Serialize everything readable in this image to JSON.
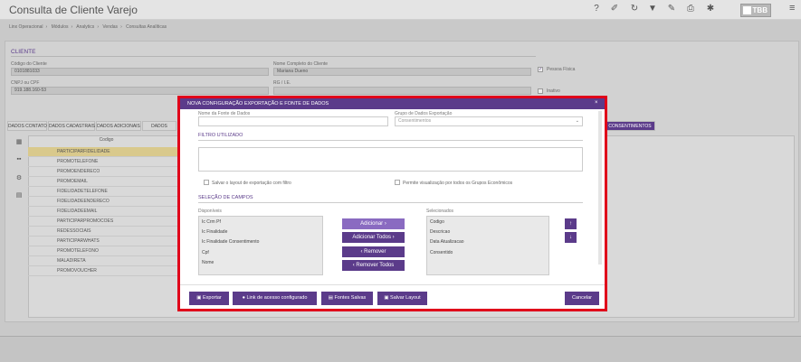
{
  "app": {
    "title": "Consulta de Cliente Varejo",
    "logo_text": "TBB"
  },
  "toolbar": {
    "icons": [
      "help-icon",
      "eraser-icon",
      "refresh-icon",
      "filter-icon",
      "edit-icon",
      "print-icon",
      "gear-icon"
    ],
    "glyphs": [
      "?",
      "✐",
      "↻",
      "▼",
      "✎",
      "⎙",
      "✱"
    ]
  },
  "breadcrumb": [
    "Linx Operacional",
    "Módulos",
    "Analytics",
    "Vendas",
    "Consultas Analíticas"
  ],
  "client": {
    "section_title": "CLIENTE",
    "code_label": "Código do Cliente",
    "code_value": "0101881033",
    "name_label": "Nome Completo do Cliente",
    "name_value": "Mariana Dueno",
    "cnpj_label": "CNPJ ou CPF",
    "cnpj_value": "919.188.160-53",
    "rg_label": "RG / I.E.",
    "rg_value": "",
    "pf_label": "Pessoa Física",
    "pf_checked": true,
    "inactive_label": "Inativo"
  },
  "tabs": [
    {
      "label": "DADOS CONTATO",
      "active": false
    },
    {
      "label": "DADOS CADASTRAIS",
      "active": false
    },
    {
      "label": "DADOS ADICIONAIS",
      "active": false
    },
    {
      "label": "DADOS",
      "active": false
    },
    {
      "label": "CONSENTIMENTOS",
      "active": true
    }
  ],
  "list": {
    "header": "Codigo",
    "rows": [
      "PARTICIPARFIDELIDADE",
      "PROMOTELEFONE",
      "PROMOENDERECO",
      "PROMOEMAIL",
      "FIDELIDADETELEFONE",
      "FIDELIDADEENDERECO",
      "FIDELIDADEEMAIL",
      "PARTICIPARPROMOCOES",
      "REDESSOCIAIS",
      "PARTICIPARWHATS",
      "PROMOTELEFONO",
      "MALADIRETA",
      "PROMOVOUCHER"
    ],
    "selected_index": 0
  },
  "modal": {
    "title": "NOVA CONFIGURAÇÃO EXPORTAÇÃO E FONTE DE DADOS",
    "source_name_label": "Nome da Fonte de Dados",
    "source_name_value": "",
    "group_label": "Grupo de Dados Exportação",
    "group_value": "Consentimentos",
    "filter_section": "FILTRO UTILIZADO",
    "save_layout_check": "Salvar o layout de exportação com filtro",
    "allow_view_check": "Permite visualização por todos os Grupos Econômicos",
    "fields_section": "SELEÇÃO DE CAMPOS",
    "available_label": "Disponíveis",
    "available": [
      "Ic Crm Pf",
      "Ic Finalidade",
      "Ic Finalidade Consentimento",
      "Cpf",
      "Nome"
    ],
    "selected_label": "Selecionados",
    "selected": [
      "Codigo",
      "Descricao",
      "Data Atualizacao",
      "Consentido"
    ],
    "btn_add": "Adicionar",
    "btn_add_all": "Adicionar Todos",
    "btn_remove": "Remover",
    "btn_remove_all": "Remover Todos",
    "btn_up": "↑",
    "btn_down": "↓",
    "footer": {
      "export": "Exportar",
      "link": "Link de acesso configurado",
      "sources": "Fontes Salvas",
      "save_layout": "Salvar Layout",
      "cancel": "Cancelar"
    }
  },
  "colors": {
    "accent": "#5b3b8a",
    "highlight": "#e0001a",
    "selected_row": "#d9c98c"
  }
}
